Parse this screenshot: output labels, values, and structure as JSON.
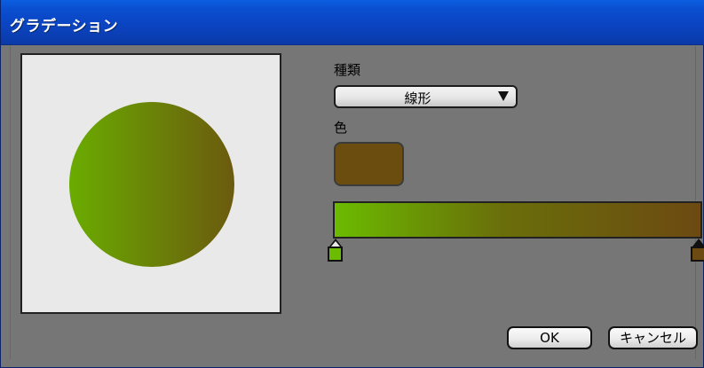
{
  "window": {
    "title": "グラデーション"
  },
  "preview": {
    "shape": "circle",
    "gradient_start_color": "#6aac00",
    "gradient_end_color": "#6b5a0f"
  },
  "type_section": {
    "label": "種類",
    "selected": "線形"
  },
  "color_section": {
    "label": "色",
    "current_color": "#6c4d10"
  },
  "gradient": {
    "stops": [
      {
        "name": "start",
        "color": "#6bbb00"
      },
      {
        "name": "end",
        "color": "#6c4a12"
      }
    ]
  },
  "buttons": {
    "ok_label": "OK",
    "cancel_label": "キャンセル"
  }
}
